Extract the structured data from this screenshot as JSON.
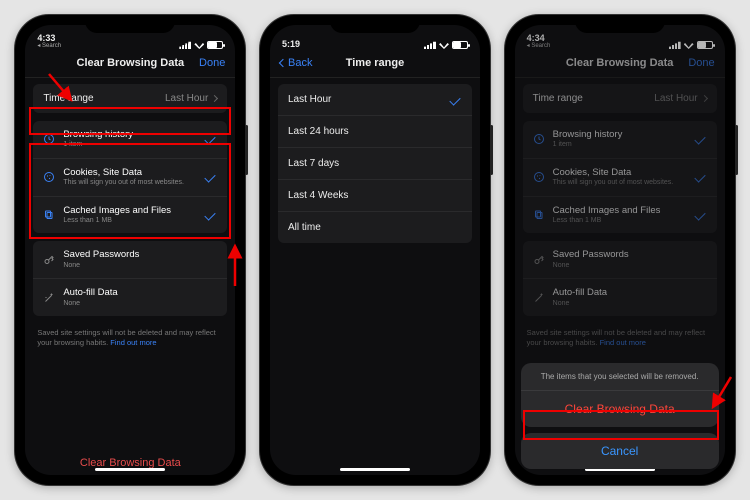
{
  "phones": {
    "p1": {
      "status": {
        "time": "4:33",
        "search": "Search",
        "battery": "38"
      },
      "header": {
        "left": "",
        "title": "Clear Browsing Data",
        "done": "Done"
      },
      "timerange": {
        "label": "Time range",
        "value": "Last Hour"
      },
      "items": [
        {
          "icon": "clock-icon",
          "label": "Browsing history",
          "sub": "1 item",
          "checked": true
        },
        {
          "icon": "cookie-icon",
          "label": "Cookies, Site Data",
          "sub": "This will sign you out of most websites.",
          "checked": true
        },
        {
          "icon": "cache-icon",
          "label": "Cached Images and Files",
          "sub": "Less than 1 MB",
          "checked": true
        }
      ],
      "items2": [
        {
          "icon": "key-icon",
          "label": "Saved Passwords",
          "sub": "None",
          "checked": false
        },
        {
          "icon": "wand-icon",
          "label": "Auto-fill Data",
          "sub": "None",
          "checked": false
        }
      ],
      "note_text": "Saved site settings will not be deleted and may reflect your browsing habits. ",
      "note_link": "Find out more",
      "action": "Clear Browsing Data"
    },
    "p2": {
      "status": {
        "time": "5:19"
      },
      "header": {
        "back": "Back",
        "title": "Time range"
      },
      "options": [
        {
          "label": "Last Hour",
          "selected": true
        },
        {
          "label": "Last 24 hours",
          "selected": false
        },
        {
          "label": "Last 7 days",
          "selected": false
        },
        {
          "label": "Last 4 Weeks",
          "selected": false
        },
        {
          "label": "All time",
          "selected": false
        }
      ]
    },
    "p3": {
      "status": {
        "time": "4:34",
        "search": "Search",
        "battery": "38"
      },
      "header": {
        "left": "",
        "title": "Clear Browsing Data",
        "done": "Done"
      },
      "timerange": {
        "label": "Time range",
        "value": "Last Hour"
      },
      "items": [
        {
          "icon": "clock-icon",
          "label": "Browsing history",
          "sub": "1 item",
          "checked": true
        },
        {
          "icon": "cookie-icon",
          "label": "Cookies, Site Data",
          "sub": "This will sign you out of most websites.",
          "checked": true
        },
        {
          "icon": "cache-icon",
          "label": "Cached Images and Files",
          "sub": "Less than 1 MB",
          "checked": true
        }
      ],
      "items2": [
        {
          "icon": "key-icon",
          "label": "Saved Passwords",
          "sub": "None",
          "checked": false
        },
        {
          "icon": "wand-icon",
          "label": "Auto-fill Data",
          "sub": "None",
          "checked": false
        }
      ],
      "note_text": "Saved site settings will not be deleted and may reflect your browsing habits. ",
      "note_link": "Find out more",
      "sheet": {
        "msg": "The items that you selected will be removed.",
        "confirm": "Clear Browsing Data",
        "cancel": "Cancel"
      }
    }
  }
}
